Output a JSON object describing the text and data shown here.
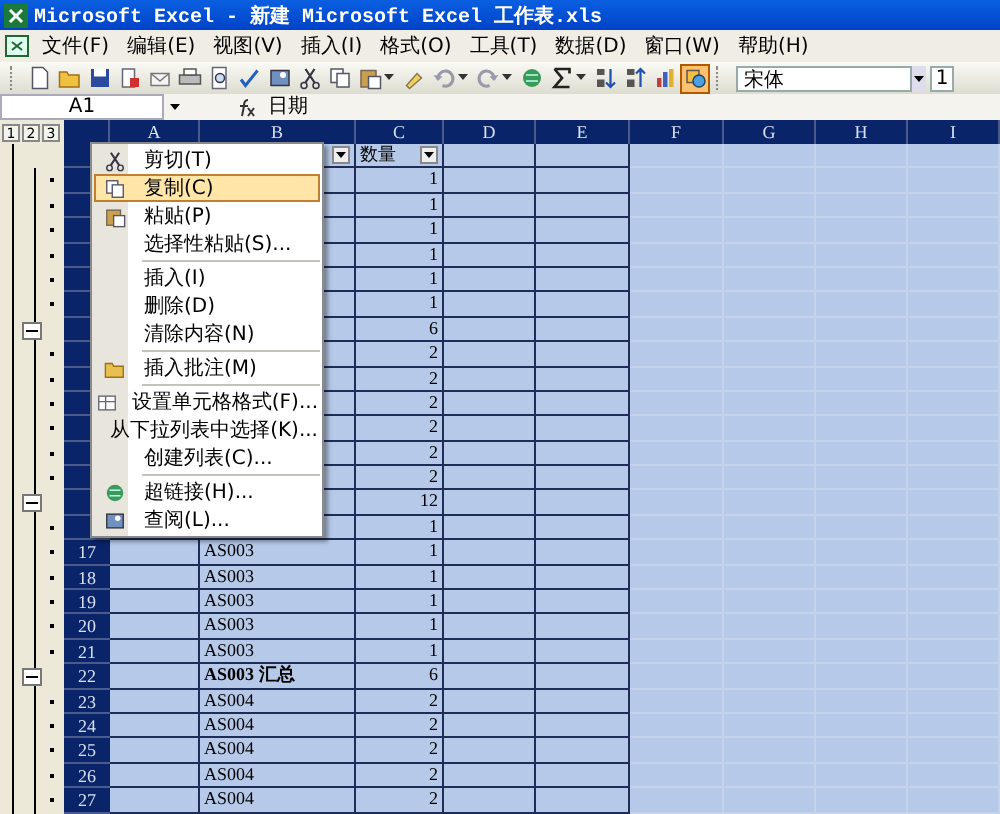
{
  "window": {
    "title": "Microsoft Excel - 新建 Microsoft Excel 工作表.xls"
  },
  "menu_bar": [
    "文件(F)",
    "编辑(E)",
    "视图(V)",
    "插入(I)",
    "格式(O)",
    "工具(T)",
    "数据(D)",
    "窗口(W)",
    "帮助(H)"
  ],
  "toolbar": {
    "buttons": [
      {
        "pressed": false
      },
      {
        "pressed": false
      },
      {
        "pressed": false
      },
      {
        "pressed": false
      },
      {
        "pressed": false
      },
      {
        "pressed": false
      },
      {
        "pressed": false
      },
      {
        "pressed": false
      },
      {
        "pressed": false
      },
      {
        "pressed": false
      },
      {
        "pressed": false
      },
      {
        "pressed": false
      },
      {
        "pressed": false
      },
      {
        "pressed": false
      },
      {
        "pressed": false
      },
      {
        "pressed": false
      },
      {
        "pressed": false
      },
      {
        "pressed": false
      },
      {
        "pressed": false
      },
      {
        "pressed": false
      },
      {
        "pressed": true
      }
    ],
    "font": "宋体",
    "font_size": "1"
  },
  "formula_bar": {
    "name_box": "A1",
    "formula": "日期"
  },
  "outline_levels": [
    "1",
    "2",
    "3"
  ],
  "columns": [
    "A",
    "B",
    "C",
    "D",
    "E",
    "F",
    "G",
    "H",
    "I"
  ],
  "rows": [
    {
      "grouped": false,
      "collapsible": false,
      "c": "数量",
      "filter": true
    },
    {
      "grouped": true,
      "collapsible": false,
      "c": "1"
    },
    {
      "grouped": true,
      "collapsible": false,
      "c": "1"
    },
    {
      "grouped": true,
      "collapsible": false,
      "c": "1"
    },
    {
      "grouped": true,
      "collapsible": false,
      "c": "1"
    },
    {
      "grouped": true,
      "collapsible": false,
      "c": "1"
    },
    {
      "grouped": true,
      "collapsible": false,
      "c": "1"
    },
    {
      "grouped": true,
      "collapsible": true,
      "c": "6"
    },
    {
      "grouped": true,
      "collapsible": false,
      "c": "2"
    },
    {
      "grouped": true,
      "collapsible": false,
      "c": "2"
    },
    {
      "grouped": true,
      "collapsible": false,
      "c": "2"
    },
    {
      "grouped": true,
      "collapsible": false,
      "c": "2"
    },
    {
      "grouped": true,
      "collapsible": false,
      "c": "2"
    },
    {
      "grouped": true,
      "collapsible": false,
      "c": "2"
    },
    {
      "grouped": true,
      "collapsible": true,
      "c": "12"
    },
    {
      "grouped": true,
      "collapsible": false,
      "c": "1"
    },
    {
      "grouped": true,
      "collapsible": false,
      "number": "17",
      "b": "AS003",
      "c": "1"
    },
    {
      "grouped": true,
      "collapsible": false,
      "number": "18",
      "b": "AS003",
      "c": "1"
    },
    {
      "grouped": true,
      "collapsible": false,
      "number": "19",
      "b": "AS003",
      "c": "1"
    },
    {
      "grouped": true,
      "collapsible": false,
      "number": "20",
      "b": "AS003",
      "c": "1"
    },
    {
      "grouped": true,
      "collapsible": false,
      "number": "21",
      "b": "AS003",
      "c": "1"
    },
    {
      "grouped": true,
      "collapsible": true,
      "number": "22",
      "b": "AS003 汇总",
      "c": "6",
      "bold": true
    },
    {
      "grouped": true,
      "collapsible": false,
      "number": "23",
      "b": "AS004",
      "c": "2"
    },
    {
      "grouped": true,
      "collapsible": false,
      "number": "24",
      "b": "AS004",
      "c": "2"
    },
    {
      "grouped": true,
      "collapsible": false,
      "number": "25",
      "b": "AS004",
      "c": "2"
    },
    {
      "grouped": true,
      "collapsible": false,
      "number": "26",
      "b": "AS004",
      "c": "2"
    },
    {
      "grouped": true,
      "collapsible": false,
      "number": "27",
      "b": "AS004",
      "c": "2"
    }
  ],
  "context_menu": [
    {
      "kind": "item",
      "label": "剪切(T)",
      "selected": false
    },
    {
      "kind": "item",
      "label": "复制(C)",
      "selected": true
    },
    {
      "kind": "item",
      "label": "粘贴(P)",
      "selected": false
    },
    {
      "kind": "item",
      "label": "选择性粘贴(S)...",
      "selected": false
    },
    {
      "kind": "separator"
    },
    {
      "kind": "item",
      "label": "插入(I)",
      "selected": false
    },
    {
      "kind": "item",
      "label": "删除(D)",
      "selected": false
    },
    {
      "kind": "item",
      "label": "清除内容(N)",
      "selected": false
    },
    {
      "kind": "separator"
    },
    {
      "kind": "item",
      "label": "插入批注(M)",
      "selected": false
    },
    {
      "kind": "separator"
    },
    {
      "kind": "item",
      "label": "设置单元格格式(F)...",
      "selected": false
    },
    {
      "kind": "item",
      "label": "从下拉列表中选择(K)...",
      "selected": false
    },
    {
      "kind": "item",
      "label": "创建列表(C)...",
      "selected": false
    },
    {
      "kind": "separator"
    },
    {
      "kind": "item",
      "label": "超链接(H)...",
      "selected": false
    },
    {
      "kind": "item",
      "label": "查阅(L)...",
      "selected": false
    }
  ]
}
